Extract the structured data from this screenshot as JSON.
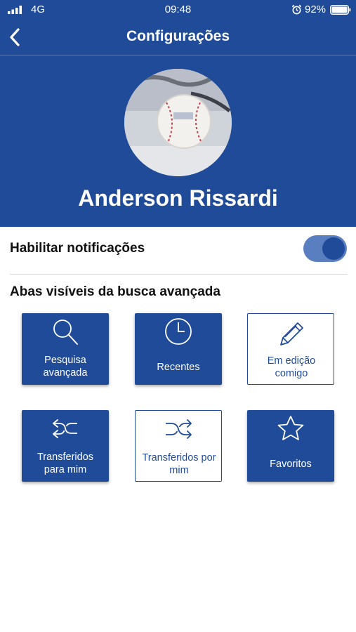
{
  "status_bar": {
    "carrier": "4G",
    "time": "09:48",
    "battery": "92%"
  },
  "nav": {
    "title": "Configurações"
  },
  "profile": {
    "name": "Anderson Rissardi"
  },
  "settings": {
    "notifications_label": "Habilitar notificações",
    "notifications_enabled": true,
    "section_title": "Abas visíveis da busca avançada"
  },
  "tabs": [
    {
      "line1": "Pesquisa",
      "line2": "avançada",
      "icon": "search-icon",
      "selected": true
    },
    {
      "line1": "Recentes",
      "line2": "",
      "icon": "clock-icon",
      "selected": true
    },
    {
      "line1": "Em edição",
      "line2": "comigo",
      "icon": "pencil-icon",
      "selected": false
    },
    {
      "line1": "Transferidos",
      "line2": "para mim",
      "icon": "transfer-in-icon",
      "selected": true
    },
    {
      "line1": "Transferidos por",
      "line2": "mim",
      "icon": "shuffle-icon",
      "selected": false
    },
    {
      "line1": "Favoritos",
      "line2": "",
      "icon": "star-icon",
      "selected": true
    }
  ],
  "colors": {
    "primary": "#1f4b99",
    "toggle_track": "#5a7fc0",
    "background": "#ffffff"
  }
}
